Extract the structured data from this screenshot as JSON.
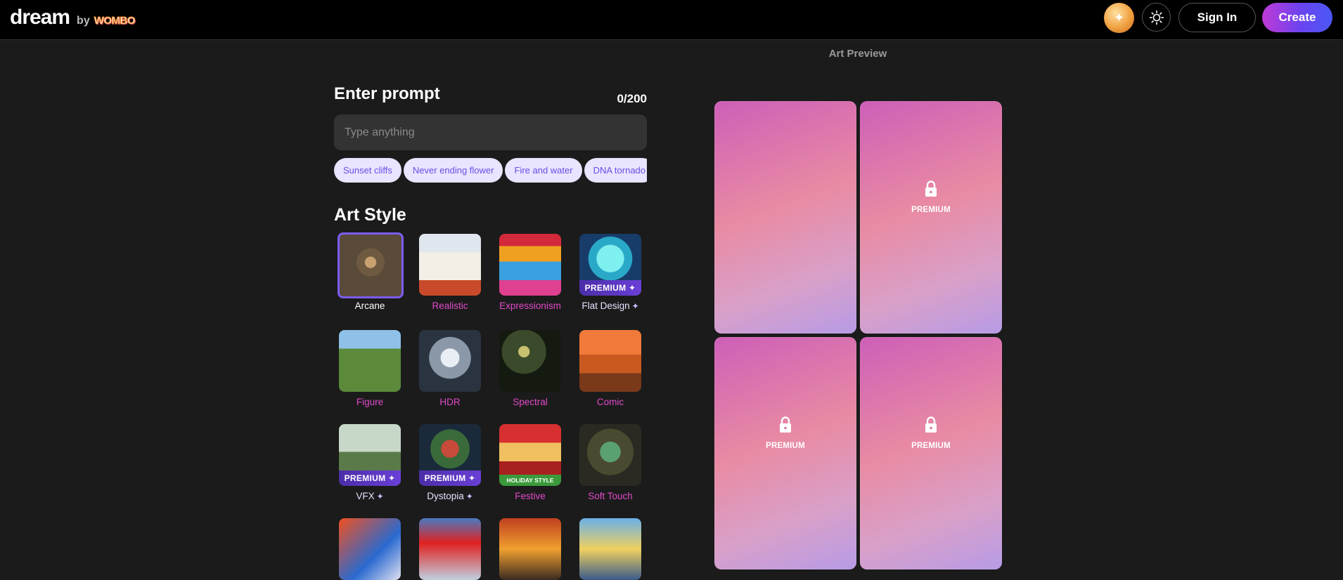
{
  "header": {
    "logo_text": "dream",
    "logo_by": "by",
    "logo_brand": "WOMBO",
    "signin_label": "Sign In",
    "create_label": "Create",
    "avatar_icon": "sparkle-avatar-icon",
    "theme_icon": "sun-icon"
  },
  "prompt": {
    "title": "Enter prompt",
    "counter": "0/200",
    "placeholder": "Type anything",
    "value": "",
    "chips": [
      "Sunset cliffs",
      "Never ending flower",
      "Fire and water",
      "DNA tornado"
    ]
  },
  "art_style": {
    "title": "Art Style",
    "selected": "Arcane",
    "styles": [
      {
        "name": "Arcane",
        "badge": ""
      },
      {
        "name": "Realistic",
        "badge": ""
      },
      {
        "name": "Expressionism",
        "badge": ""
      },
      {
        "name": "Flat Design",
        "badge": "PREMIUM"
      },
      {
        "name": "Figure",
        "badge": ""
      },
      {
        "name": "HDR",
        "badge": ""
      },
      {
        "name": "Spectral",
        "badge": ""
      },
      {
        "name": "Comic",
        "badge": ""
      },
      {
        "name": "VFX",
        "badge": "PREMIUM"
      },
      {
        "name": "Dystopia",
        "badge": "PREMIUM"
      },
      {
        "name": "Festive",
        "badge": "HOLIDAY STYLE"
      },
      {
        "name": "Soft Touch",
        "badge": ""
      }
    ]
  },
  "preview": {
    "title": "Art Preview",
    "cards": [
      {
        "locked": false,
        "label": ""
      },
      {
        "locked": true,
        "label": "PREMIUM"
      },
      {
        "locked": true,
        "label": "PREMIUM"
      },
      {
        "locked": true,
        "label": "PREMIUM"
      }
    ]
  },
  "colors": {
    "accent": "#7b5cf2",
    "style_label": "#e14ac9",
    "chip_bg": "#e9e4ff",
    "chip_text": "#6b4de6",
    "background": "#1b1b1b"
  }
}
